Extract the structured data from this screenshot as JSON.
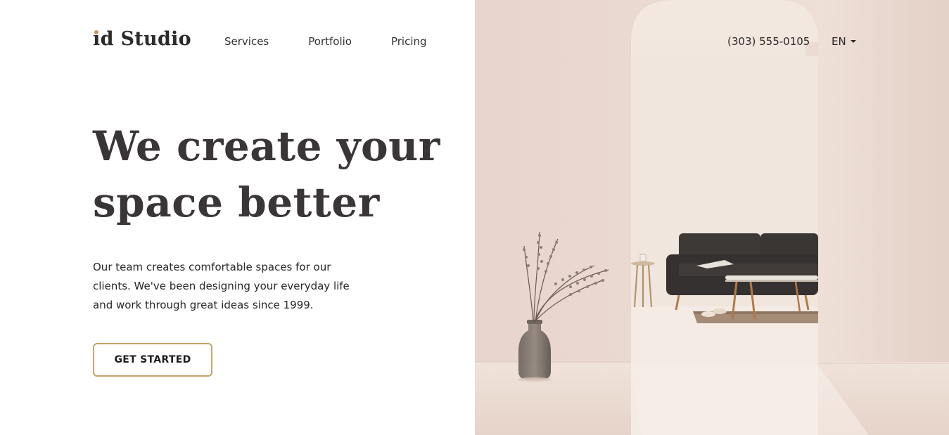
{
  "brand": {
    "logo_i": "i",
    "logo_rest": "d Studio",
    "accent_color": "#c49a5c"
  },
  "nav": {
    "items": [
      {
        "label": "Services"
      },
      {
        "label": "Portfolio"
      },
      {
        "label": "Pricing"
      }
    ]
  },
  "header": {
    "phone": "(303) 555-0105",
    "language": "EN",
    "language_icon": "chevron-down-icon"
  },
  "hero": {
    "headline_line1": "We create your",
    "headline_line2": "space better",
    "description": "Our team creates comfortable spaces for our clients. We've been designing your everyday life and work through great ideas since 1999.",
    "cta_label": "GET STARTED",
    "cta_border_color": "#c8a46b",
    "image_alt": "Minimalist beige interior with dark sofa, coffee table and vase with dried grass"
  }
}
